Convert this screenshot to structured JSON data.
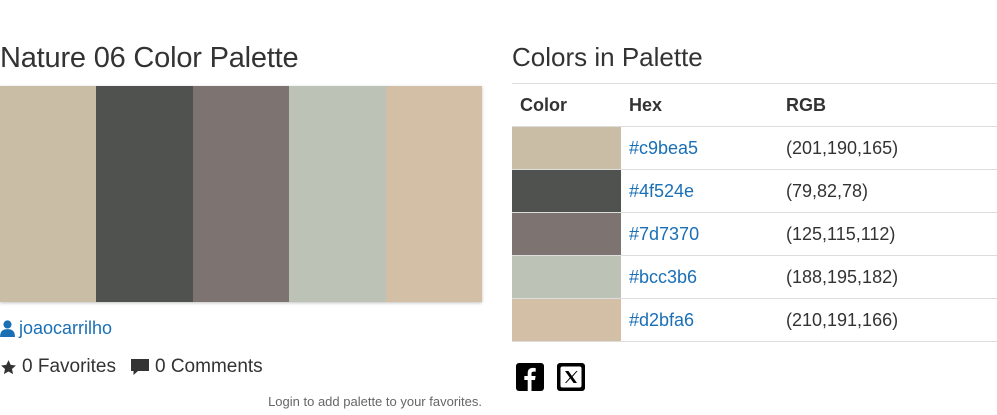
{
  "palette": {
    "title": "Nature 06 Color Palette",
    "author": "joaocarrilho",
    "favorites_label": "0 Favorites",
    "comments_label": "0 Comments",
    "login_note": "Login to add palette to your favorites."
  },
  "colors_section": {
    "heading": "Colors in Palette",
    "columns": [
      "Color",
      "Hex",
      "RGB"
    ],
    "rows": [
      {
        "hex": "#c9bea5",
        "rgb": "(201,190,165)"
      },
      {
        "hex": "#4f524e",
        "rgb": "(79,82,78)"
      },
      {
        "hex": "#7d7370",
        "rgb": "(125,115,112)"
      },
      {
        "hex": "#bcc3b6",
        "rgb": "(188,195,182)"
      },
      {
        "hex": "#d2bfa6",
        "rgb": "(210,191,166)"
      }
    ]
  },
  "share": {
    "icons": [
      "facebook-icon",
      "x-icon"
    ]
  },
  "colors": {
    "link": "#1a6fb5",
    "text": "#333333",
    "muted": "#666666",
    "border": "#dddddd"
  }
}
